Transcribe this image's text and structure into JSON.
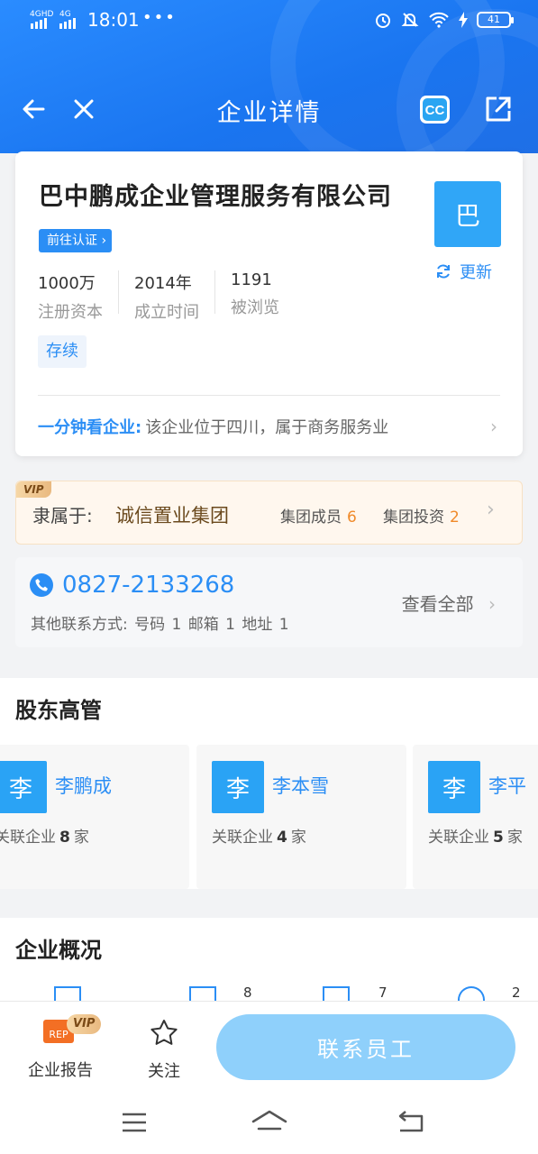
{
  "status_bar": {
    "network_1": "4GHD",
    "network_2": "4G",
    "time": "18:01",
    "extra": "•••",
    "battery": "41"
  },
  "nav": {
    "title": "企业详情"
  },
  "company": {
    "name": "巴中鹏成企业管理服务有限公司",
    "verify_label": "前往认证",
    "logo_char": "巴",
    "refresh_label": "更新",
    "stats": [
      {
        "value": "1000万",
        "label": "注册资本"
      },
      {
        "value": "2014年",
        "label": "成立时间"
      },
      {
        "value": "1191",
        "label": "被浏览"
      }
    ],
    "status_tag": "存续",
    "quick_title": "一分钟看企业:",
    "quick_desc": "该企业位于四川，属于商务服务业"
  },
  "group": {
    "badge": "VIP",
    "label": "隶属于:",
    "name": "诚信置业集团",
    "members_label": "集团成员",
    "members_count": "6",
    "invest_label": "集团投资",
    "invest_count": "2"
  },
  "contact": {
    "phone": "0827-2133268",
    "other": "其他联系方式: 号码 1  邮箱 1  地址 1",
    "view_all": "查看全部"
  },
  "shareholders": {
    "title": "股东高管",
    "people": [
      {
        "avatar": "李",
        "name": "李鹏成",
        "rel_prefix": "关联企业",
        "count": "8",
        "rel_suffix": "家"
      },
      {
        "avatar": "李",
        "name": "李本雪",
        "rel_prefix": "关联企业",
        "count": "4",
        "rel_suffix": "家"
      },
      {
        "avatar": "李",
        "name": "李平",
        "rel_prefix": "关联企业",
        "count": "5",
        "rel_suffix": "家"
      }
    ]
  },
  "overview": {
    "title": "企业概况",
    "counts": [
      "8",
      "7",
      "2"
    ]
  },
  "bottom_bar": {
    "report_label": "企业报告",
    "report_badge": "VIP",
    "report_icon_text": "REP",
    "follow_label": "关注",
    "contact_button": "联系员工"
  },
  "colors": {
    "brand_blue": "#2b8ef5",
    "header_blue": "#1a75f0",
    "vip_gold": "#e9b980",
    "count_orange": "#f08a2a"
  }
}
